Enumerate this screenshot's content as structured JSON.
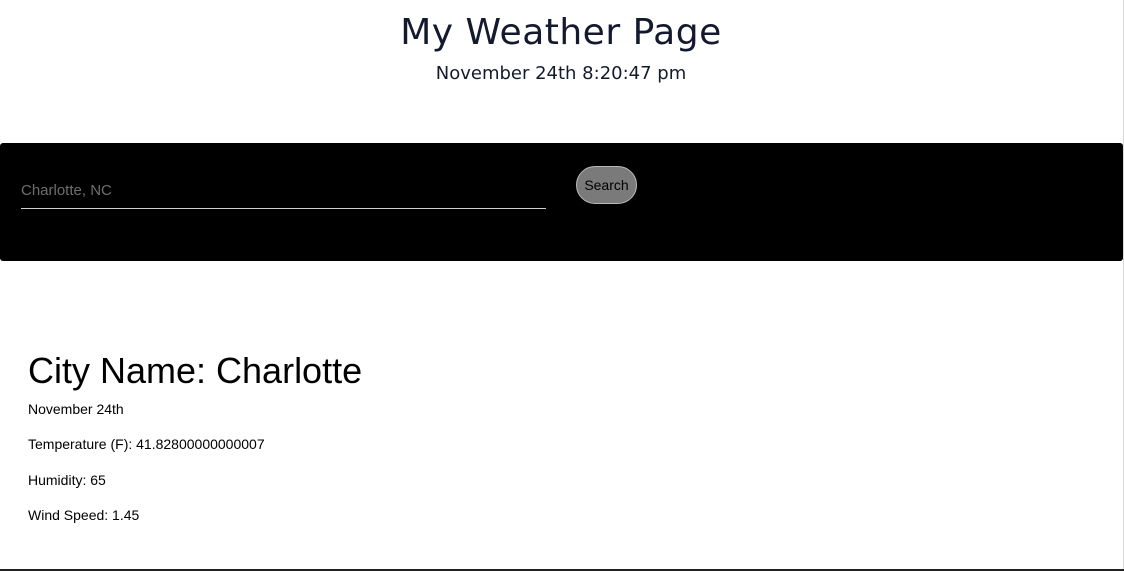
{
  "header": {
    "title": "My Weather Page",
    "clock": "November 24th 8:20:47 pm"
  },
  "search": {
    "placeholder": "Charlotte, NC",
    "value": "",
    "button_label": "Search"
  },
  "result": {
    "city_heading": "City Name: Charlotte",
    "date": "November 24th",
    "temperature": "Temperature (F): 41.82800000000007",
    "humidity": "Humidity: 65",
    "wind_speed": "Wind Speed: 1.45"
  },
  "colors": {
    "panel_background": "#000000",
    "button_background": "#7a7a7a",
    "title_text": "#141a2e"
  }
}
